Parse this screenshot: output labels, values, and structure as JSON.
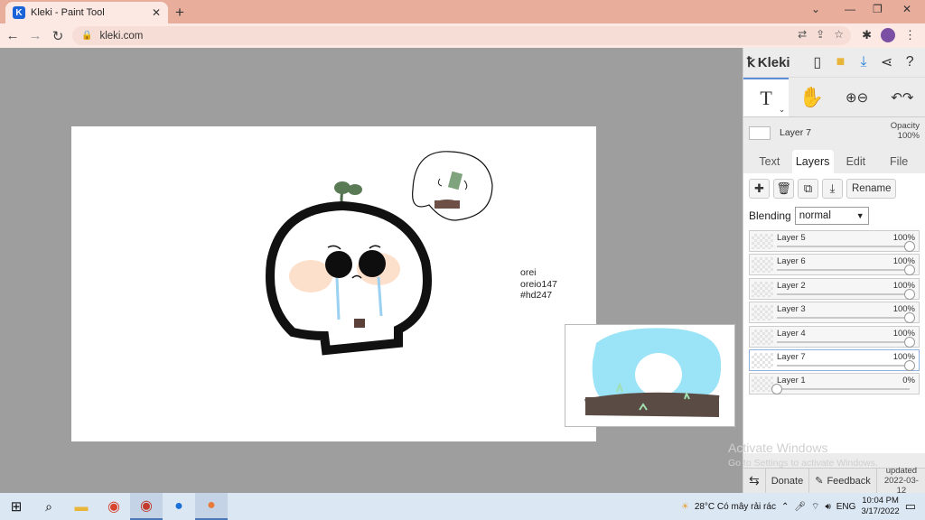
{
  "browser": {
    "tab_title": "Kleki - Paint Tool",
    "tab_favicon": "K",
    "url": "kleki.com"
  },
  "canvas": {
    "signature": [
      "orei",
      "oreio147",
      "#hd247"
    ]
  },
  "panel": {
    "logo": "Kleki",
    "current_layer": "Layer 7",
    "opacity_label": "Opacity",
    "opacity_value": "100%",
    "tabs": [
      "Text",
      "Layers",
      "Edit",
      "File"
    ],
    "active_tab": "Layers",
    "rename_label": "Rename",
    "blending_label": "Blending",
    "blending_value": "normal",
    "layers": [
      {
        "name": "Layer 5",
        "opacity": "100%",
        "level": 1.0
      },
      {
        "name": "Layer 6",
        "opacity": "100%",
        "level": 1.0
      },
      {
        "name": "Layer 2",
        "opacity": "100%",
        "level": 1.0
      },
      {
        "name": "Layer 3",
        "opacity": "100%",
        "level": 1.0
      },
      {
        "name": "Layer 4",
        "opacity": "100%",
        "level": 1.0
      },
      {
        "name": "Layer 7",
        "opacity": "100%",
        "level": 1.0
      },
      {
        "name": "Layer 1",
        "opacity": "0%",
        "level": 0.0
      }
    ],
    "active_layer": "Layer 7",
    "bottom": {
      "donate": "Donate",
      "feedback": "Feedback",
      "updated_label": "updated",
      "updated_date": "2022-03-12"
    }
  },
  "watermark": {
    "title": "Activate Windows",
    "subtitle": "Go to Settings to activate Windows."
  },
  "taskbar": {
    "weather": "28°C  Có mây rải rác",
    "language": "ENG",
    "time": "10:04 PM",
    "date": "3/17/2022"
  },
  "colors": {
    "tabbar": "#e9ad9c",
    "toolbar": "#fde9e3",
    "canvas_bg": "#9e9e9e",
    "sky": "#9be3f7",
    "ground": "#5a4b44"
  }
}
